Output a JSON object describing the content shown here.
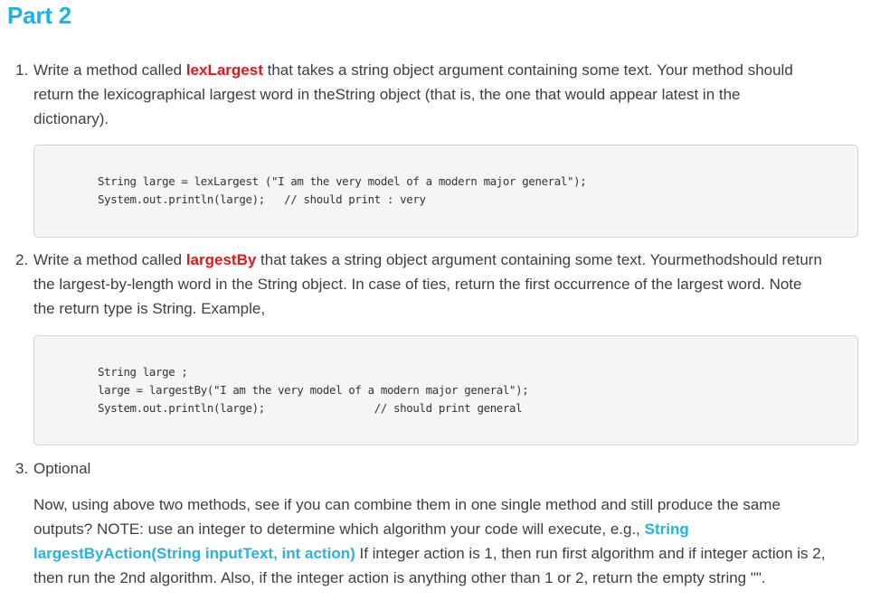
{
  "title": "Part 2",
  "q1": {
    "number": "1.",
    "line1_pre": "Write a method called ",
    "method": "lexLargest",
    "line1_post": " that takes a string object argument containing some text. Your method should",
    "line2": "return the lexicographical largest word in theString object (that is, the one that would appear latest in the",
    "line3": "dictionary).",
    "code": [
      "String large = lexLargest (\"I am the very model of a modern major general\");",
      "System.out.println(large);   // should print : very"
    ]
  },
  "q2": {
    "number": "2.",
    "line1_pre": "Write a method called ",
    "method": "largestBy",
    "line1_post": " that takes a string object argument containing some text. Yourmethodshould return",
    "line2": "the largest-by-length word in the String object. In case of ties, return the first occurrence of the largest word. Note",
    "line3": "the return type is String. Example,",
    "code": [
      "String large ;",
      "large = largestBy(\"I am the very model of a modern major general\");",
      "System.out.println(large);                 // should print general"
    ]
  },
  "q3": {
    "number": "3.",
    "heading": "Optional",
    "line1": "Now, using above two methods, see if you can combine them in one single method and still produce the same",
    "line2_pre": "outputs? NOTE: use an integer to determine which algorithm your code will execute, e.g., ",
    "line2_sig": "String",
    "line3_sig": "largestByAction(String inputText, int action)",
    "line3_post": " If integer action is 1, then run first algorithm and if integer action is 2,",
    "line4": "then run the 2nd algorithm. Also, if the integer action is anything other than 1 or 2, return the empty string \"\"."
  },
  "colors": {
    "title": "#1ab2e8",
    "method_highlight": "#e8141b",
    "signature_highlight": "#27b1e6",
    "body_text": "#3b3f44",
    "code_bg": "#f5f5f5"
  }
}
